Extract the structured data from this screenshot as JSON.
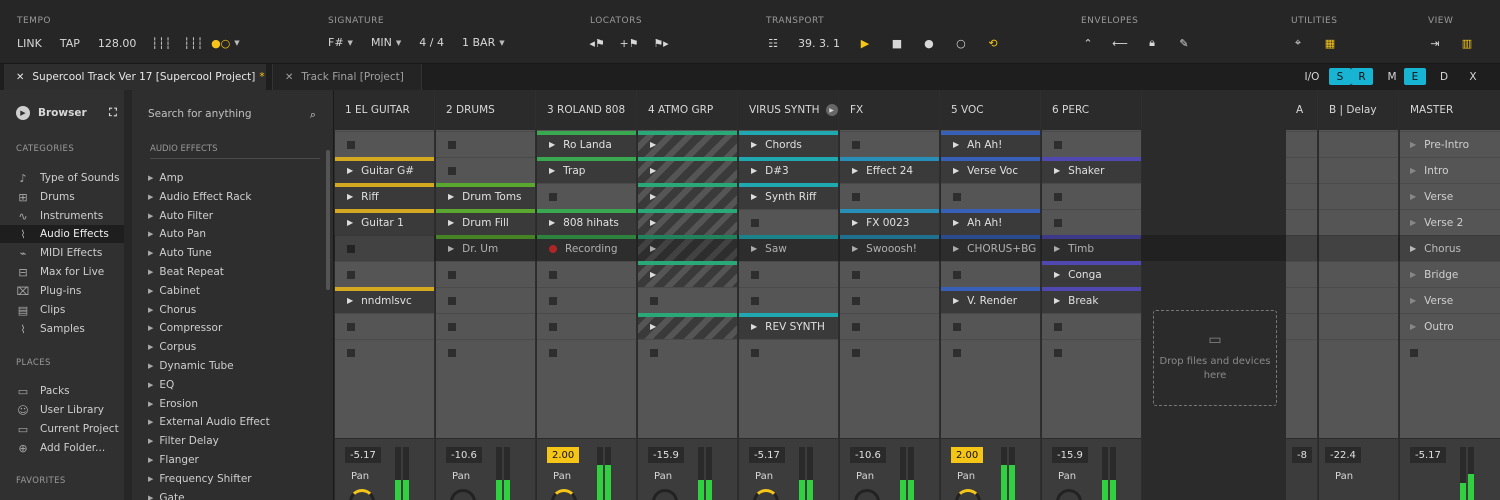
{
  "colors": {
    "accent": "#f5c518",
    "blue": "#18b4d4",
    "dark": "#262626"
  },
  "header": {
    "tempo": {
      "title": "TEMPO",
      "link": "LINK",
      "tap": "TAP",
      "bpm": "128.00"
    },
    "signature": {
      "title": "SIGNATURE",
      "key": "F#",
      "scale": "MIN",
      "meter": "4 / 4",
      "quant": "1 BAR"
    },
    "locators": {
      "title": "LOCATORS"
    },
    "transport": {
      "title": "TRANSPORT",
      "position": "39.  3.  1"
    },
    "envelopes": {
      "title": "ENVELOPES"
    },
    "utilities": {
      "title": "UTILITIES"
    },
    "view": {
      "title": "VIEW"
    }
  },
  "tabs": [
    {
      "label": "Supercool Track Ver 17 [Supercool Project]",
      "dirty": "*"
    },
    {
      "label": "Track Final [Project]"
    }
  ],
  "view_toggles": [
    "I/O",
    "S",
    "R",
    "M",
    "E",
    "D",
    "X"
  ],
  "browser": {
    "title": "Browser",
    "categories_title": "CATEGORIES",
    "categories": [
      "Type of Sounds",
      "Drums",
      "Instruments",
      "Audio Effects",
      "MIDI Effects",
      "Max for Live",
      "Plug-ins",
      "Clips",
      "Samples"
    ],
    "places_title": "PLACES",
    "places": [
      "Packs",
      "User Library",
      "Current Project",
      "Add Folder..."
    ],
    "favorites_title": "FAVORITES",
    "search_placeholder": "Search for anything",
    "list_title": "AUDIO EFFECTS",
    "effects": [
      "Amp",
      "Audio Effect Rack",
      "Auto Filter",
      "Auto Pan",
      "Auto Tune",
      "Beat Repeat",
      "Cabinet",
      "Chorus",
      "Compressor",
      "Corpus",
      "Dynamic Tube",
      "EQ",
      "Erosion",
      "External Audio Effect",
      "Filter Delay",
      "Flanger",
      "Frequency Shifter",
      "Gate"
    ]
  },
  "tracks": [
    {
      "name": "1 EL GUITAR",
      "color": "#d4a820",
      "vol": "-5.17",
      "clips": [
        "",
        "Guitar G#",
        "Riff",
        "Guitar 1",
        "",
        "",
        "nndmlsvc",
        "",
        ""
      ]
    },
    {
      "name": "2 DRUMS",
      "color": "#5aa830",
      "vol": "-10.6",
      "clips": [
        "",
        "",
        "Drum Toms",
        "Drum Fill",
        "Dr. Um",
        "",
        "",
        "",
        ""
      ]
    },
    {
      "name": "3 ROLAND 808",
      "color": "#3aa850",
      "vol": "2.00",
      "clips": [
        "Ro Landa",
        "Trap",
        "",
        "808 hihats",
        "Recording",
        "",
        "",
        "",
        ""
      ]
    },
    {
      "name": "4 ATMO GRP",
      "color": "#2aa878",
      "vol": "-15.9",
      "clips": [
        "",
        "",
        "",
        "",
        "",
        "",
        "",
        "",
        ""
      ]
    },
    {
      "name": "VIRUS SYNTH",
      "color": "#20a8b0",
      "vol": "-5.17",
      "clips": [
        "Chords",
        "D#3",
        "Synth Riff",
        "",
        "Saw",
        "",
        "",
        "REV SYNTH",
        ""
      ]
    },
    {
      "name": "FX",
      "color": "#2890b8",
      "vol": "-10.6",
      "clips": [
        "",
        "Effect 24",
        "",
        "FX 0023",
        "Swooosh!",
        "",
        "",
        "",
        ""
      ]
    },
    {
      "name": "5 VOC",
      "color": "#3860b8",
      "vol": "2.00",
      "clips": [
        "Ah Ah!",
        "Verse Voc",
        "",
        "Ah Ah!",
        "CHORUS+BG",
        "",
        "V. Render",
        "",
        ""
      ]
    },
    {
      "name": "6 PERC",
      "color": "#5048b0",
      "vol": "-15.9",
      "clips": [
        "",
        "Shaker",
        "",
        "",
        "Timb",
        "Conga",
        "Break",
        "",
        ""
      ]
    }
  ],
  "drop_text": "Drop files and devices here",
  "returns": [
    {
      "name": "A",
      "vol": "-8"
    },
    {
      "name": "B | Delay",
      "vol": "-22.4"
    }
  ],
  "master": {
    "name": "MASTER",
    "vol": "-5.17",
    "scenes": [
      "Pre-Intro",
      "Intro",
      "Verse",
      "Verse 2",
      "Chorus",
      "Bridge",
      "Verse",
      "Outro",
      ""
    ]
  },
  "pan_label": "Pan"
}
